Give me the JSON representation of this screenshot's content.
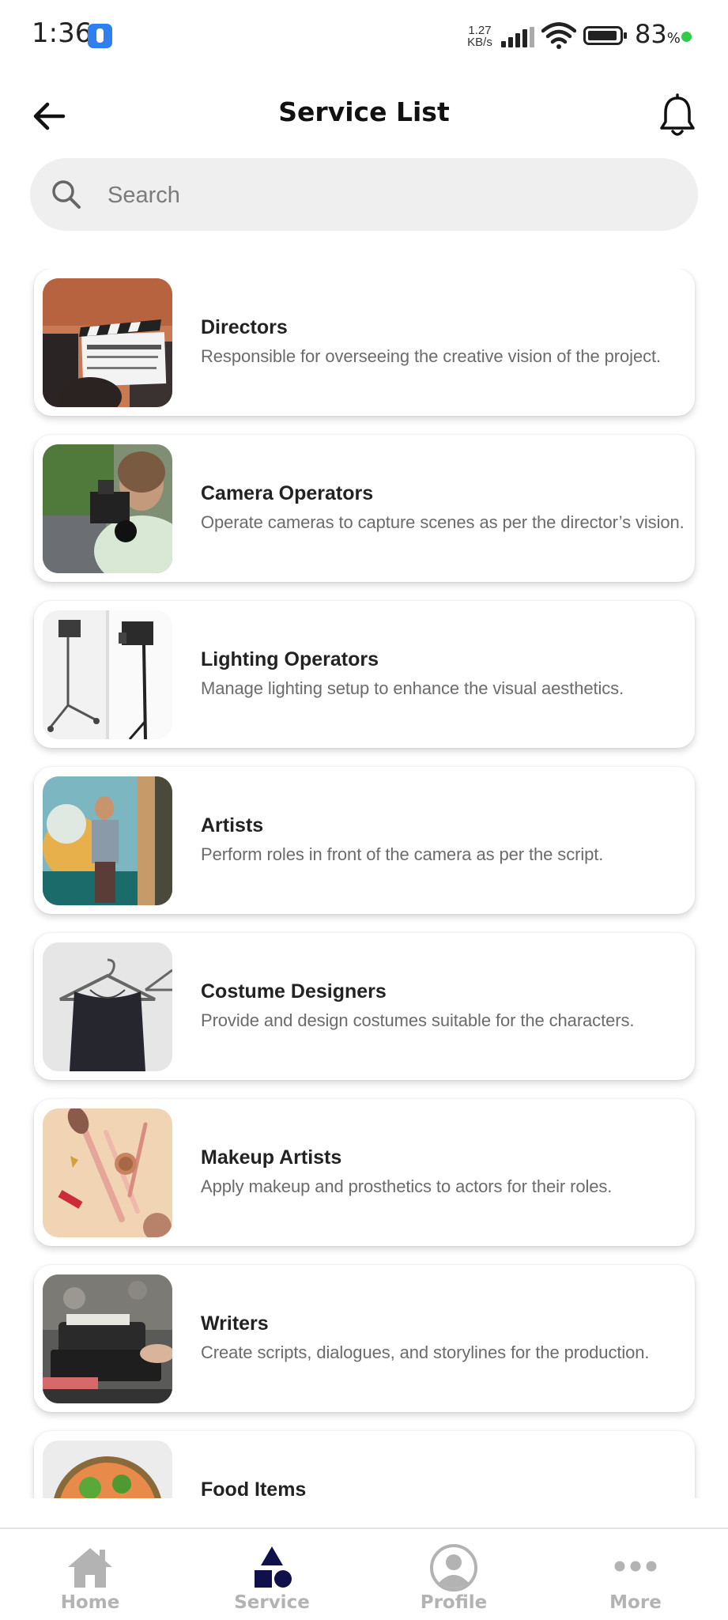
{
  "status_bar": {
    "time": "1:36",
    "net_speed_value": "1.27",
    "net_speed_unit": "KB/s",
    "battery_percent": "83",
    "battery_unit": "%"
  },
  "header": {
    "title": "Service List",
    "back_icon": "arrow-left-icon",
    "notification_icon": "bell-icon"
  },
  "search": {
    "placeholder": "Search",
    "value": ""
  },
  "services": [
    {
      "title": "Directors",
      "description": "Responsible for overseeing the creative vision of the project.",
      "image": "clapperboard"
    },
    {
      "title": "Camera Operators",
      "description": "Operate cameras to capture scenes as per the director’s vision.",
      "image": "camera-operator"
    },
    {
      "title": "Lighting Operators",
      "description": "Manage lighting setup to enhance the visual aesthetics.",
      "image": "studio-lights"
    },
    {
      "title": "Artists",
      "description": "Perform roles in front of the camera as per the script.",
      "image": "artist-mural"
    },
    {
      "title": "Costume Designers",
      "description": "Provide and design costumes suitable for the characters.",
      "image": "dress-hanger"
    },
    {
      "title": "Makeup Artists",
      "description": "Apply makeup and prosthetics to actors for their roles.",
      "image": "makeup-brushes"
    },
    {
      "title": "Writers",
      "description": "Create scripts, dialogues, and storylines for the production.",
      "image": "typewriter"
    },
    {
      "title": "Food Items",
      "description": "",
      "image": "food-bowl"
    }
  ],
  "bottom_nav": {
    "items": [
      {
        "label": "Home",
        "icon": "home-icon",
        "active": false
      },
      {
        "label": "Service",
        "icon": "shapes-icon",
        "active": true
      },
      {
        "label": "Profile",
        "icon": "profile-icon",
        "active": false
      },
      {
        "label": "More",
        "icon": "more-dots-icon",
        "active": false
      }
    ]
  },
  "colors": {
    "active_nav": "#10104a",
    "inactive_nav": "#b3b3b3",
    "search_bg": "#efefef",
    "title_text": "#222222",
    "description_text": "#6b6b6b"
  }
}
